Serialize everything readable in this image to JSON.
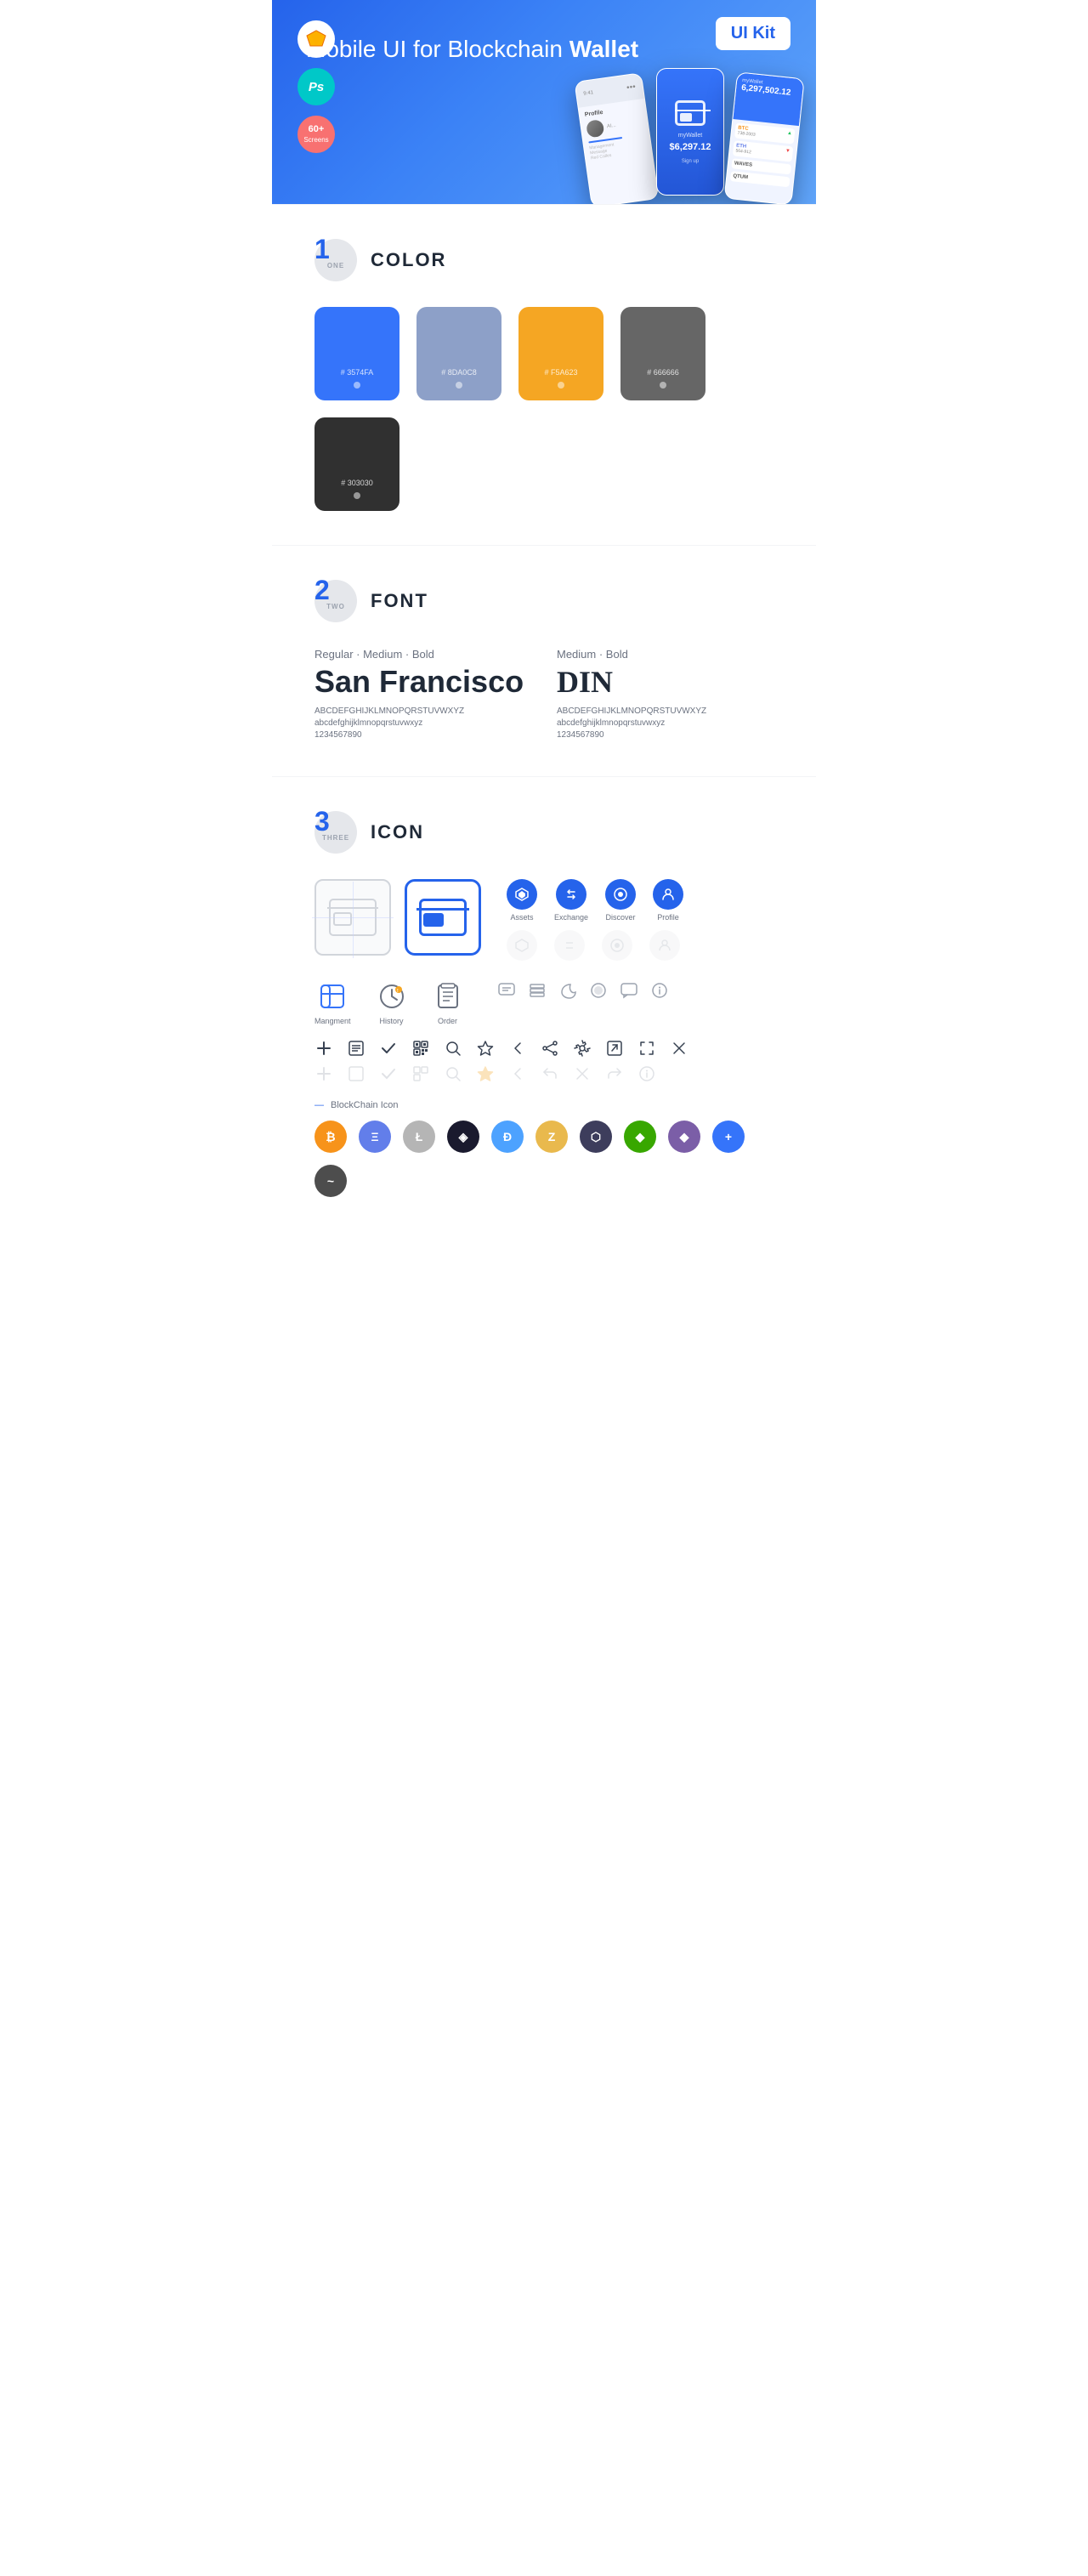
{
  "hero": {
    "title_normal": "Mobile UI for Blockchain",
    "title_bold": "Wallet",
    "badge": "UI Kit",
    "sketch_label": "Sketch",
    "ps_label": "Ps",
    "screens_label": "60+\nScreens"
  },
  "sections": {
    "color": {
      "number": "1",
      "number_text": "ONE",
      "title": "COLOR",
      "swatches": [
        {
          "hex": "#3574FA",
          "label": "#\n3574FA",
          "bg": "#3574FA"
        },
        {
          "hex": "#8DA0C8",
          "label": "#\n8DA0C8",
          "bg": "#8DA0C8"
        },
        {
          "hex": "#F5A623",
          "label": "#\nF5A623",
          "bg": "#F5A623"
        },
        {
          "hex": "#666666",
          "label": "#\n666666",
          "bg": "#666666"
        },
        {
          "hex": "#303030",
          "label": "#\n303030",
          "bg": "#303030"
        }
      ]
    },
    "font": {
      "number": "2",
      "number_text": "TWO",
      "title": "FONT",
      "font1": {
        "meta": "Regular · Medium · Bold",
        "name": "San Francisco",
        "upper": "ABCDEFGHIJKLMNOPQRSTUVWXYZ",
        "lower": "abcdefghijklmnopqrstuvwxyz",
        "nums": "1234567890"
      },
      "font2": {
        "meta": "Medium · Bold",
        "name": "DIN",
        "upper": "ABCDEFGHIJKLMNOPQRSTUVWXYZ",
        "lower": "abcdefghijklmnopqrstuvwxyz",
        "nums": "1234567890"
      }
    },
    "icon": {
      "number": "3",
      "number_text": "THREE",
      "title": "ICON",
      "nav_icons": [
        {
          "label": "Assets",
          "color": "#2563eb"
        },
        {
          "label": "Exchange",
          "color": "#2563eb"
        },
        {
          "label": "Discover",
          "color": "#2563eb"
        },
        {
          "label": "Profile",
          "color": "#2563eb"
        }
      ],
      "tab_icons": [
        {
          "label": "Mangment"
        },
        {
          "label": "History"
        },
        {
          "label": "Order"
        }
      ],
      "blockchain_label": "BlockChain Icon",
      "crypto_coins": [
        {
          "symbol": "₿",
          "color": "#f7931a",
          "name": "Bitcoin"
        },
        {
          "symbol": "Ξ",
          "color": "#627eea",
          "name": "Ethereum"
        },
        {
          "symbol": "Ł",
          "color": "#a6a9aa",
          "name": "Litecoin"
        },
        {
          "symbol": "◈",
          "color": "#0e76fd",
          "name": "Stratis"
        },
        {
          "symbol": "Ð",
          "color": "#4da2ff",
          "name": "Dash"
        },
        {
          "symbol": "Z",
          "color": "#e9b94d",
          "name": "Zcash"
        },
        {
          "symbol": "◎",
          "color": "#8a92b2",
          "name": "Grid"
        },
        {
          "symbol": "⬡",
          "color": "#38a700",
          "name": "Waves"
        },
        {
          "symbol": "◆",
          "color": "#7b5ea7",
          "name": "Diamond"
        },
        {
          "symbol": "+",
          "color": "#3574FA",
          "name": "Plus"
        },
        {
          "symbol": "∞",
          "color": "#4d4d4d",
          "name": "Other"
        }
      ]
    }
  }
}
